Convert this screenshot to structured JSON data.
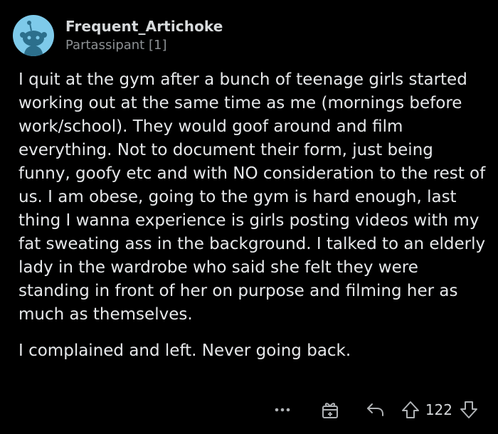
{
  "comment": {
    "author": "Frequent_Artichoke",
    "flair": "Partassipant [1]",
    "paragraphs": [
      "I quit at the gym after a bunch of teenage girls started working out at the same time as me (mornings before work/school). They would goof around and film everything. Not to document their form, just being funny, goofy etc and with NO consideration to the rest of us. I am obese, going to the gym is hard enough, last thing I wanna experience is girls posting videos with my fat sweating ass in the background. I talked to an elderly lady in the wardrobe who said she felt they were standing in front of her on purpose and filming her as much as themselves.",
      "I complained and left. Never going back."
    ],
    "score": "122",
    "icons": {
      "avatar": "snoo-avatar-icon",
      "more": "more-options-icon",
      "award": "award-icon",
      "reply": "reply-icon",
      "upvote": "upvote-icon",
      "downvote": "downvote-icon"
    },
    "colors": {
      "background": "#000000",
      "avatar_bg": "#7ecaea",
      "text": "#e6e8ea",
      "muted": "#8d9194"
    }
  }
}
